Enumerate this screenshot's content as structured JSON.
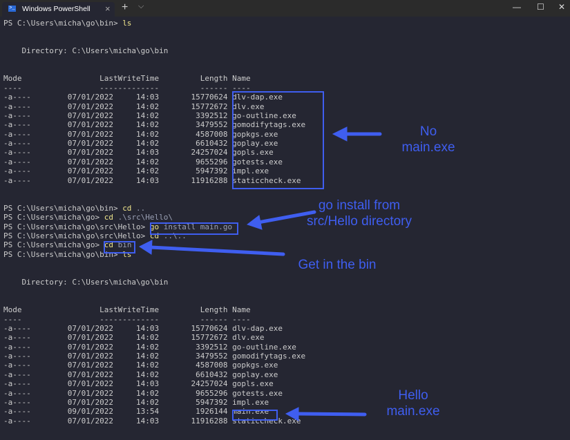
{
  "window": {
    "tab_title": "Windows PowerShell",
    "tab_icon": "powershell-icon",
    "close_tab": "×",
    "new_tab": "+",
    "dropdown": "⌵",
    "minimize": "—",
    "maximize": "☐",
    "close": "✕"
  },
  "terminal": {
    "lines": [
      [
        {
          "t": "PS C:\\Users\\micha\\go\\bin> "
        },
        {
          "t": "ls",
          "c": "cmd"
        }
      ],
      [],
      [],
      [
        {
          "t": "    Directory: C:\\Users\\micha\\go\\bin"
        }
      ],
      [],
      [],
      [
        {
          "t": "Mode                 LastWriteTime         Length Name"
        }
      ],
      [
        {
          "t": "----                 -------------         ------ ----"
        }
      ],
      [
        {
          "t": "-a----        07/01/2022     14:03       15770624 dlv-dap.exe"
        }
      ],
      [
        {
          "t": "-a----        07/01/2022     14:02       15772672 dlv.exe"
        }
      ],
      [
        {
          "t": "-a----        07/01/2022     14:02        3392512 go-outline.exe"
        }
      ],
      [
        {
          "t": "-a----        07/01/2022     14:02        3479552 gomodifytags.exe"
        }
      ],
      [
        {
          "t": "-a----        07/01/2022     14:02        4587008 gopkgs.exe"
        }
      ],
      [
        {
          "t": "-a----        07/01/2022     14:02        6610432 goplay.exe"
        }
      ],
      [
        {
          "t": "-a----        07/01/2022     14:03       24257024 gopls.exe"
        }
      ],
      [
        {
          "t": "-a----        07/01/2022     14:02        9655296 gotests.exe"
        }
      ],
      [
        {
          "t": "-a----        07/01/2022     14:02        5947392 impl.exe"
        }
      ],
      [
        {
          "t": "-a----        07/01/2022     14:03       11916288 staticcheck.exe"
        }
      ],
      [],
      [],
      [
        {
          "t": "PS C:\\Users\\micha\\go\\bin> "
        },
        {
          "t": "cd",
          "c": "cmd"
        },
        {
          "t": " ..",
          "c": "arg"
        }
      ],
      [
        {
          "t": "PS C:\\Users\\micha\\go> "
        },
        {
          "t": "cd",
          "c": "cmd"
        },
        {
          "t": " .\\src\\Hello\\",
          "c": "arg"
        }
      ],
      [
        {
          "t": "PS C:\\Users\\micha\\go\\src\\Hello> "
        },
        {
          "t": "go",
          "c": "cmd"
        },
        {
          "t": " install main.go",
          "c": "arg"
        }
      ],
      [
        {
          "t": "PS C:\\Users\\micha\\go\\src\\Hello> "
        },
        {
          "t": "cd",
          "c": "cmd"
        },
        {
          "t": " ..\\..",
          "c": "arg"
        }
      ],
      [
        {
          "t": "PS C:\\Users\\micha\\go> "
        },
        {
          "t": "cd",
          "c": "cmd"
        },
        {
          "t": " bin",
          "c": "arg"
        }
      ],
      [
        {
          "t": "PS C:\\Users\\micha\\go\\bin> "
        },
        {
          "t": "ls",
          "c": "cmd"
        }
      ],
      [],
      [],
      [
        {
          "t": "    Directory: C:\\Users\\micha\\go\\bin"
        }
      ],
      [],
      [],
      [
        {
          "t": "Mode                 LastWriteTime         Length Name"
        }
      ],
      [
        {
          "t": "----                 -------------         ------ ----"
        }
      ],
      [
        {
          "t": "-a----        07/01/2022     14:03       15770624 dlv-dap.exe"
        }
      ],
      [
        {
          "t": "-a----        07/01/2022     14:02       15772672 dlv.exe"
        }
      ],
      [
        {
          "t": "-a----        07/01/2022     14:02        3392512 go-outline.exe"
        }
      ],
      [
        {
          "t": "-a----        07/01/2022     14:02        3479552 gomodifytags.exe"
        }
      ],
      [
        {
          "t": "-a----        07/01/2022     14:02        4587008 gopkgs.exe"
        }
      ],
      [
        {
          "t": "-a----        07/01/2022     14:02        6610432 goplay.exe"
        }
      ],
      [
        {
          "t": "-a----        07/01/2022     14:03       24257024 gopls.exe"
        }
      ],
      [
        {
          "t": "-a----        07/01/2022     14:02        9655296 gotests.exe"
        }
      ],
      [
        {
          "t": "-a----        07/01/2022     14:02        5947392 impl.exe"
        }
      ],
      [
        {
          "t": "-a----        09/01/2022     13:54        1926144 main.exe"
        }
      ],
      [
        {
          "t": "-a----        07/01/2022     14:03       11916288 staticcheck.exe"
        }
      ]
    ]
  },
  "annotations": {
    "color": "#3f5ef0",
    "no_main_line1": "No",
    "no_main_line2": "main.exe",
    "go_install_line1": "go install from",
    "go_install_line2": "src/Hello directory",
    "get_in_bin": "Get in the bin",
    "hello_line1": "Hello",
    "hello_line2": "main.exe"
  }
}
